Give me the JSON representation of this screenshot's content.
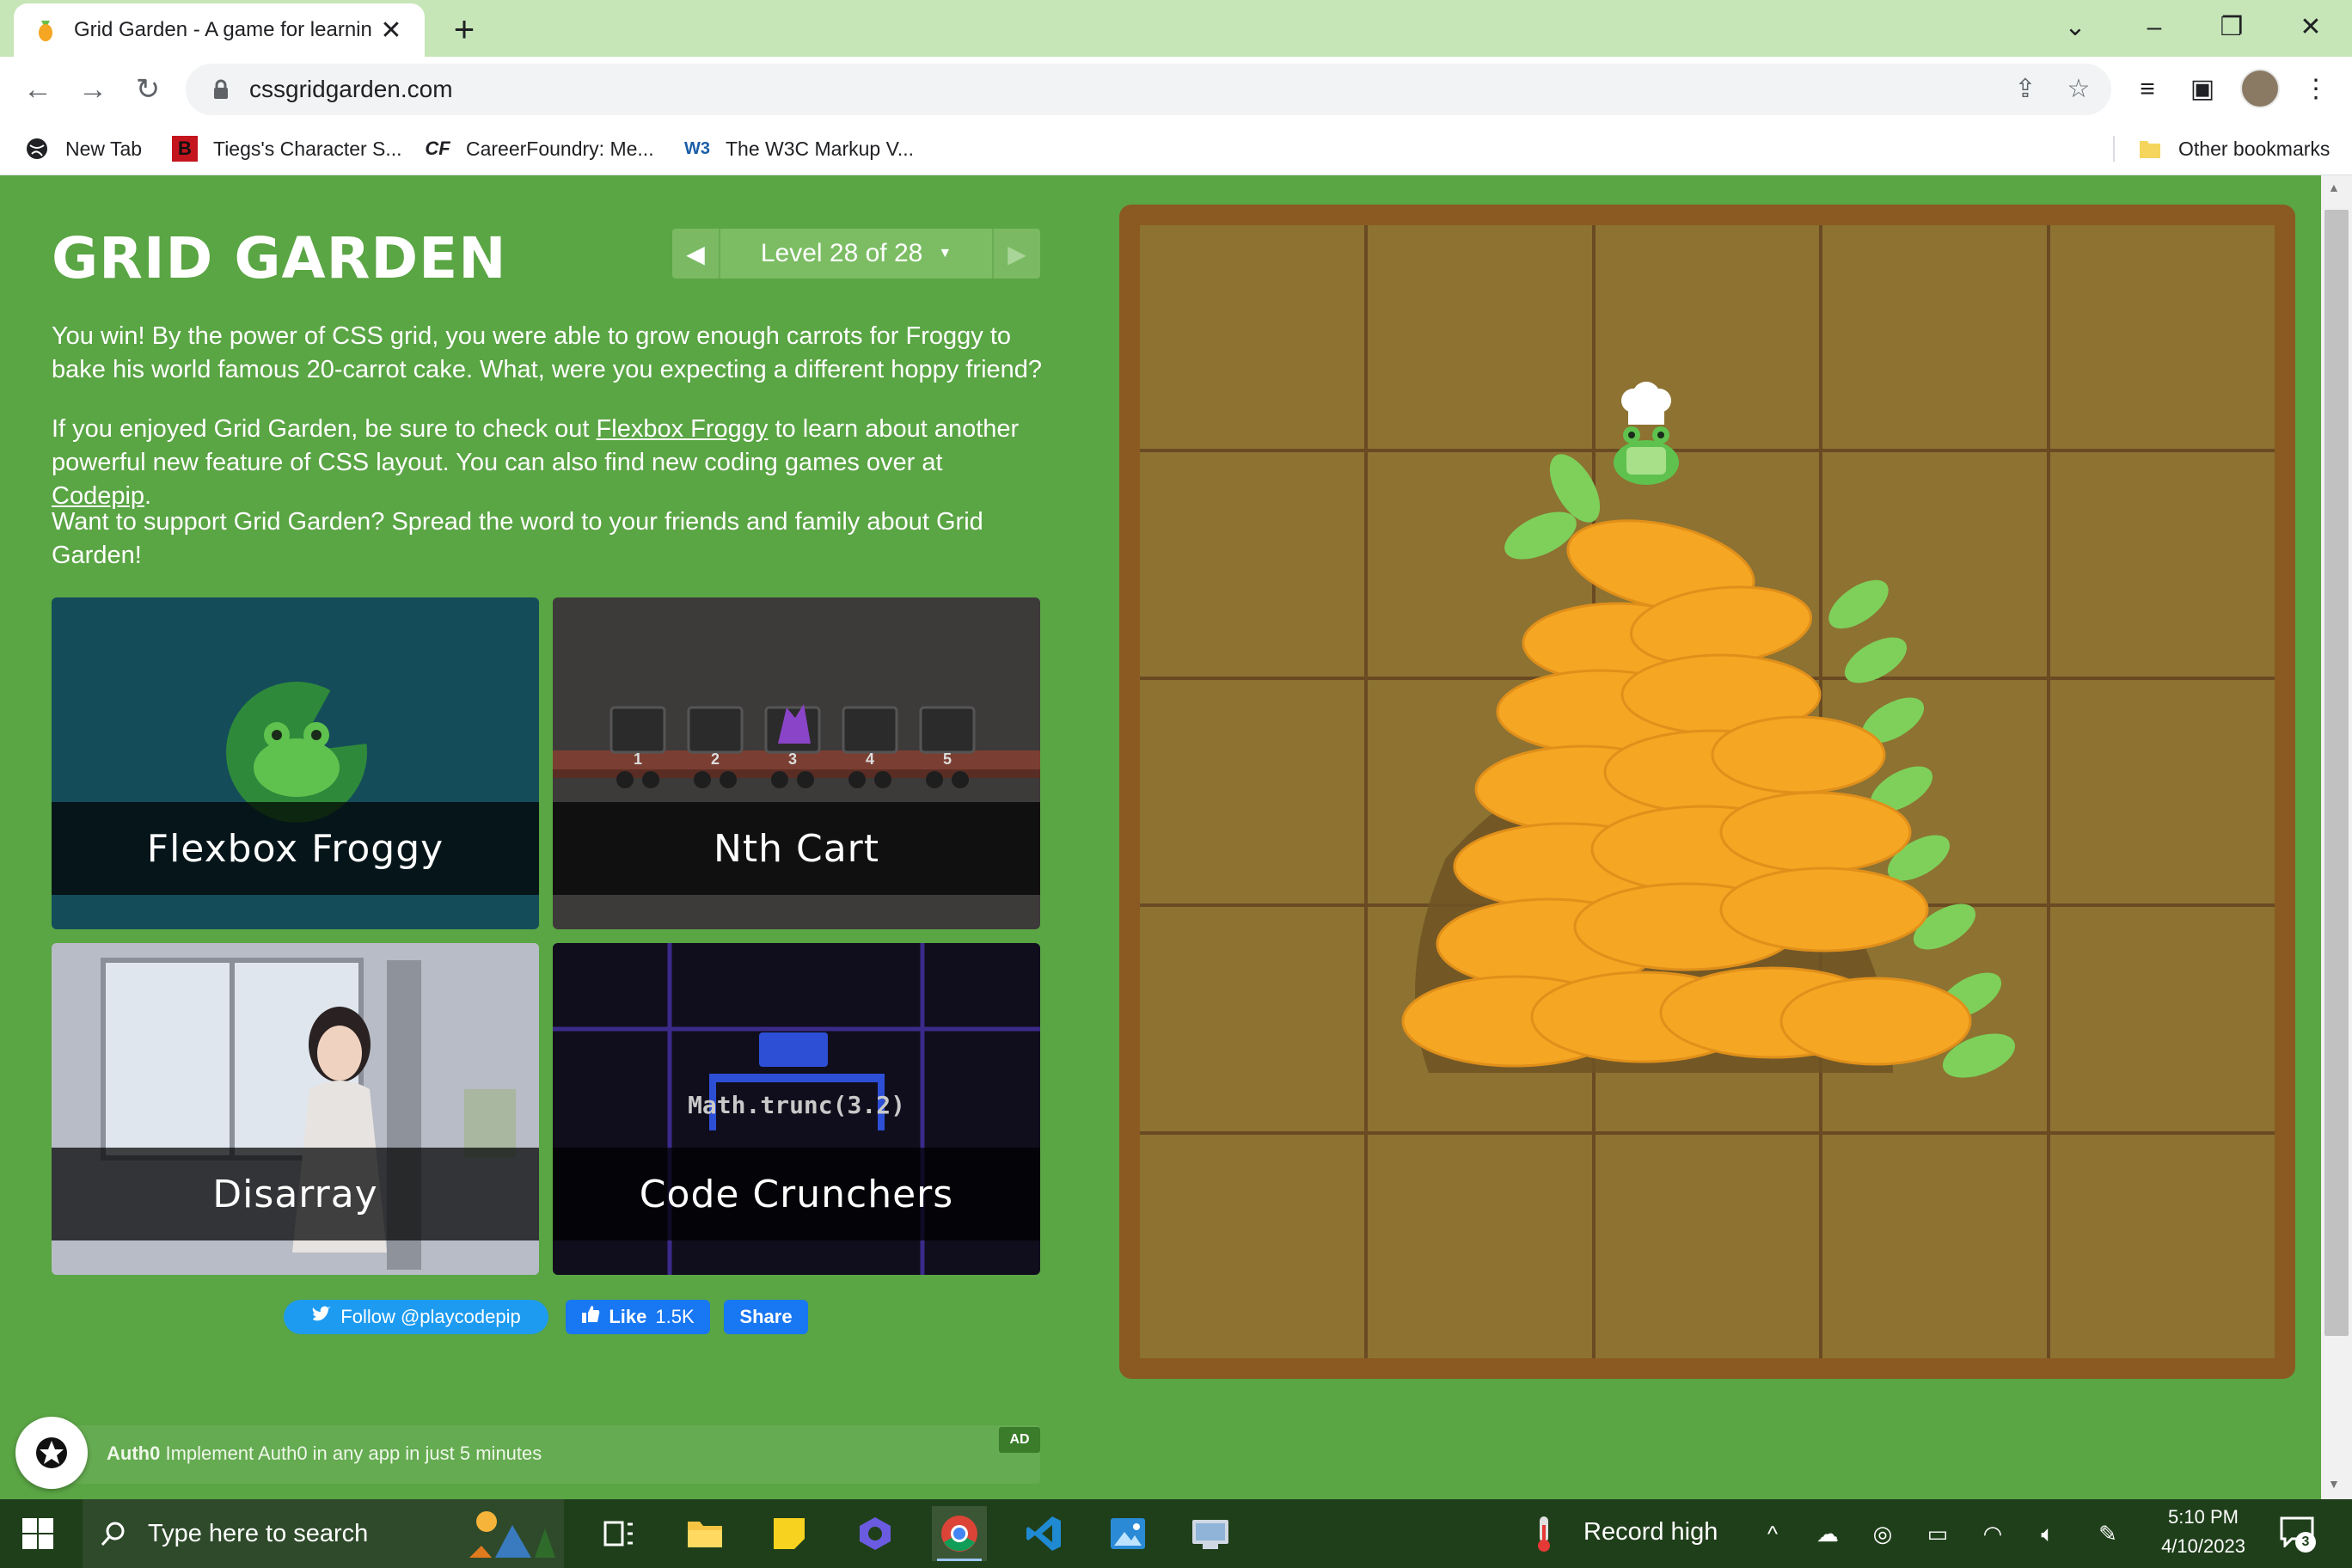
{
  "browser": {
    "tab_title": "Grid Garden - A game for learnin",
    "url": "cssgridgarden.com",
    "bookmarks": [
      {
        "label": "New Tab",
        "icon": "globe-icon"
      },
      {
        "label": "Tiegs's Character S...",
        "icon": "b-logo-icon"
      },
      {
        "label": "CareerFoundry: Me...",
        "icon": "cf-logo-icon"
      },
      {
        "label": "The W3C Markup V...",
        "icon": "w3c-logo-icon"
      }
    ],
    "other_bookmarks": "Other bookmarks"
  },
  "page": {
    "title": "GRID GARDEN",
    "level_label": "Level 28 of 28",
    "para1": "You win! By the power of CSS grid, you were able to grow enough carrots for Froggy to bake his world famous 20-carrot cake. What, were you expecting a different hoppy friend?",
    "para2_a": "If you enjoyed Grid Garden, be sure to check out ",
    "para2_link1": "Flexbox Froggy",
    "para2_b": " to learn about another powerful new feature of CSS layout. You can also find new coding games over at ",
    "para2_link2": "Codepip",
    "para2_c": ".",
    "para3": "Want to support Grid Garden? Spread the word to your friends and family about Grid Garden!",
    "games": [
      {
        "label": "Flexbox Froggy"
      },
      {
        "label": "Nth Cart",
        "cart_numbers": [
          "1",
          "2",
          "3",
          "4",
          "5"
        ]
      },
      {
        "label": "Disarray"
      },
      {
        "label": "Code Crunchers",
        "code_text": "Math.trunc(3.2)"
      }
    ],
    "follow_label": "Follow @playcodepip",
    "like_label": "Like",
    "like_count": "1.5K",
    "share_label": "Share",
    "ad_brand": "Auth0",
    "ad_text": "Implement Auth0 in any app in just 5 minutes",
    "ad_tag": "AD"
  },
  "taskbar": {
    "search_placeholder": "Type here to search",
    "weather_text": "Record high",
    "time": "5:10 PM",
    "date": "4/10/2023",
    "notification_count": "3"
  },
  "colors": {
    "page_bg": "#5aa544",
    "tabstrip_bg": "#c6e6b8",
    "garden_border": "#8a5a22",
    "soil": "#8d7232",
    "carrot": "#f5a623",
    "leaf": "#7ed05a",
    "taskbar_bg": "#1f3f1a"
  }
}
